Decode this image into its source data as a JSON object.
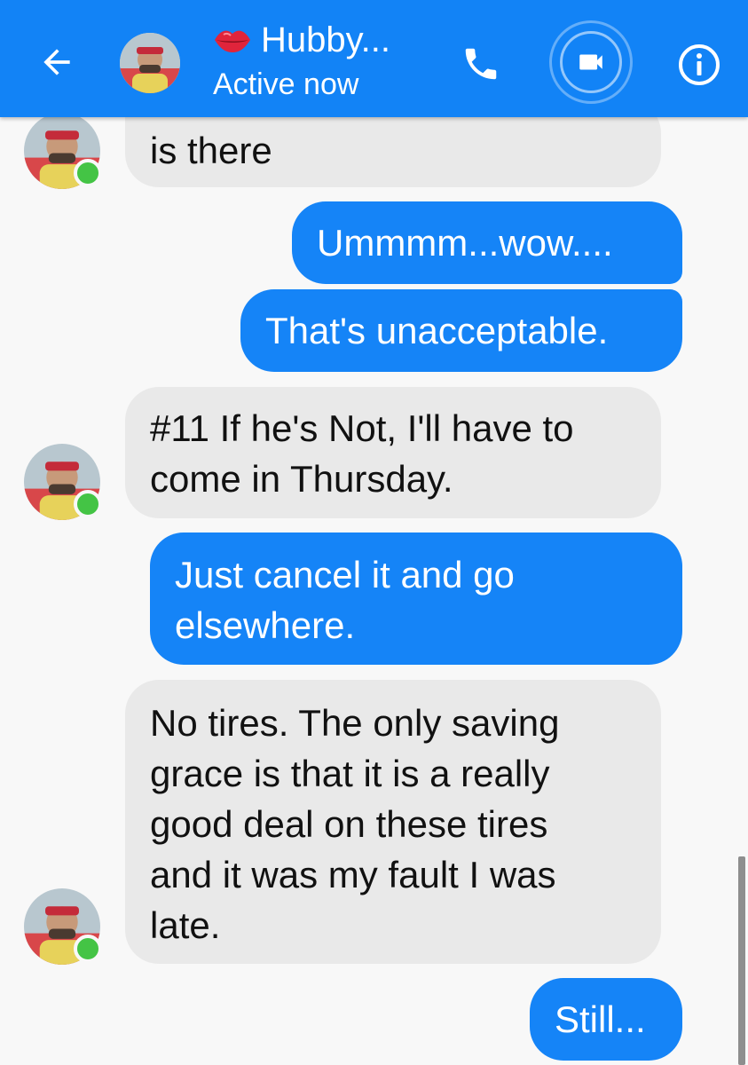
{
  "header": {
    "contact_name": "Hubby...",
    "status": "Active now",
    "accent_color": "#1283f6",
    "icons": [
      "back-arrow-icon",
      "lips-icon",
      "phone-icon",
      "video-camera-icon",
      "info-icon"
    ]
  },
  "messages": [
    {
      "from": "them",
      "text": "is there"
    },
    {
      "from": "me",
      "text": "Ummmm...wow...."
    },
    {
      "from": "me",
      "text": "That's unacceptable."
    },
    {
      "from": "them",
      "text_lines": [
        "#11 If he's Not, I'll have to",
        "come in Thursday."
      ]
    },
    {
      "from": "me",
      "text_lines": [
        "Just cancel it and go",
        "elsewhere."
      ]
    },
    {
      "from": "them",
      "text_lines": [
        "No tires. The only saving",
        "grace is that it is a really",
        "good deal on these tires",
        "and it was my fault I was",
        "late."
      ]
    },
    {
      "from": "me",
      "text": "Still..."
    }
  ],
  "colors": {
    "incoming_bubble": "#e9e9e9",
    "outgoing_bubble": "#1584f7",
    "online_dot": "#44c445"
  }
}
